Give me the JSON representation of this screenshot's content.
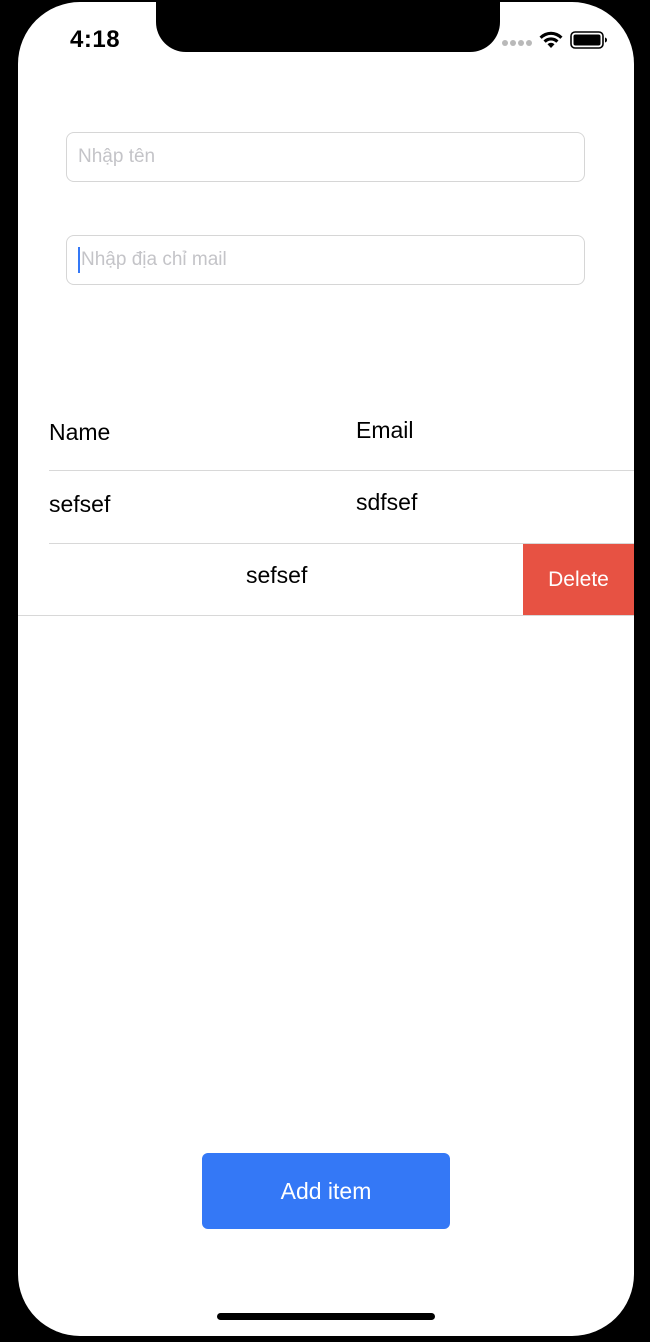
{
  "status_bar": {
    "time": "4:18",
    "signal_icon": "signal-dots-icon",
    "wifi_icon": "wifi-icon",
    "battery_icon": "battery-icon"
  },
  "form": {
    "name_placeholder": "Nhập tên",
    "email_placeholder": "Nhập địa chỉ mail"
  },
  "table": {
    "headers": {
      "name": "Name",
      "email": "Email"
    },
    "rows": [
      {
        "name": "sefsef",
        "email": "sdfsef"
      },
      {
        "name": "sefsef",
        "email": ""
      }
    ],
    "delete_label": "Delete"
  },
  "actions": {
    "add_label": "Add item"
  },
  "colors": {
    "accent": "#3478f6",
    "delete": "#e75243",
    "placeholder": "#c4c4c8",
    "divider": "#d8d8d8"
  }
}
